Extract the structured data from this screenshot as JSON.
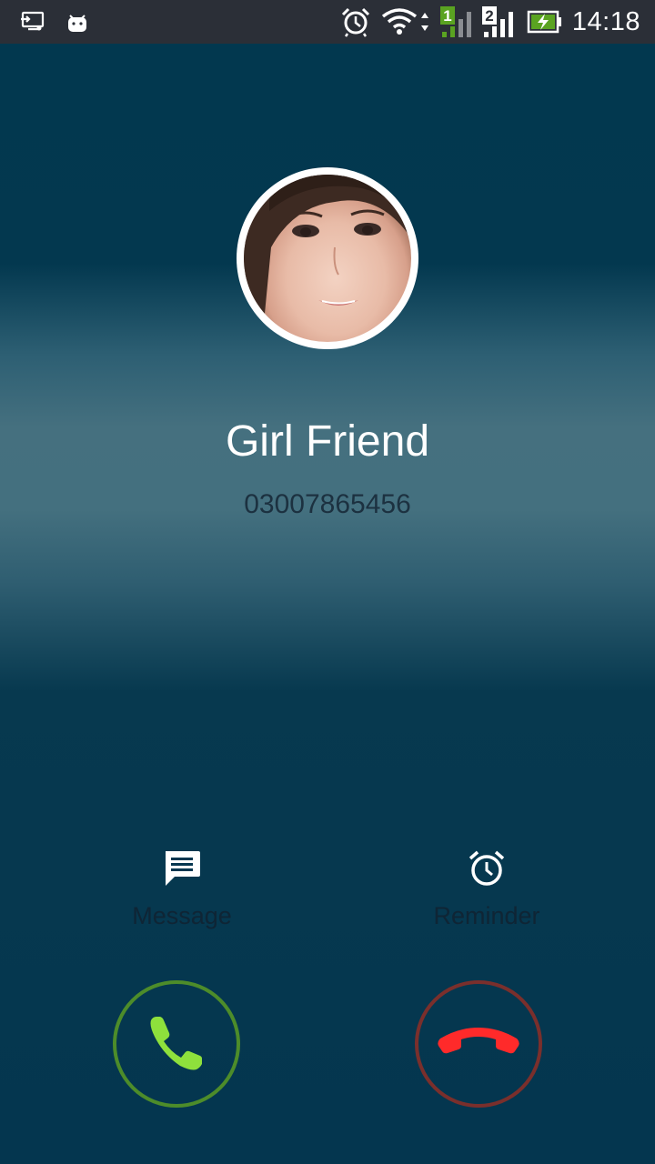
{
  "status_bar": {
    "time": "14:18",
    "sim1_label": "1",
    "sim2_label": "2",
    "icons": [
      "screen-cast-icon",
      "android-icon",
      "alarm-icon",
      "wifi-icon",
      "signal-sim1-icon",
      "signal-sim2-icon",
      "battery-charging-icon"
    ],
    "colors": {
      "background": "#2b2f37",
      "sim1_badge": "#5aa321",
      "battery_fill": "#5aa321"
    }
  },
  "caller": {
    "name": "Girl Friend",
    "number": "03007865456"
  },
  "actions": {
    "message_label": "Message",
    "reminder_label": "Reminder"
  },
  "call_buttons": {
    "answer_icon": "phone-answer-icon",
    "decline_icon": "phone-decline-icon",
    "colors": {
      "answer": "#8ee03c",
      "answer_ring": "#4d8c2a",
      "decline": "#ff2a2a",
      "decline_ring": "#7a2f2c"
    }
  }
}
